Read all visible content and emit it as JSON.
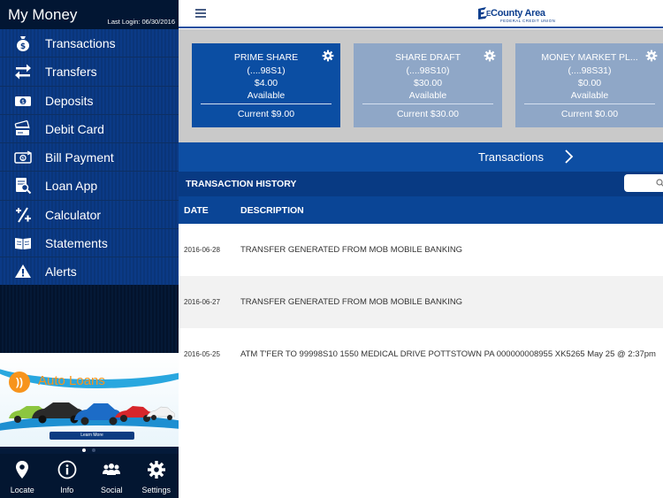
{
  "sidebar": {
    "title": "My Money",
    "last_login": "Last Login: 06/30/2016",
    "items": [
      {
        "label": "Transactions",
        "icon": "money-bag-icon"
      },
      {
        "label": "Transfers",
        "icon": "transfer-arrows-icon"
      },
      {
        "label": "Deposits",
        "icon": "camera-deposit-icon"
      },
      {
        "label": "Debit Card",
        "icon": "debit-card-icon"
      },
      {
        "label": "Bill Payment",
        "icon": "bill-payment-icon"
      },
      {
        "label": "Loan App",
        "icon": "loan-app-icon"
      },
      {
        "label": "Calculator",
        "icon": "calculator-icon"
      },
      {
        "label": "Statements",
        "icon": "statements-book-icon"
      },
      {
        "label": "Alerts",
        "icon": "alert-icon"
      }
    ]
  },
  "ad": {
    "title": "Auto Loans",
    "button": "Learn More",
    "badge": "))"
  },
  "bottom_nav": [
    {
      "label": "Locate",
      "icon": "location-pin-icon"
    },
    {
      "label": "Info",
      "icon": "info-icon"
    },
    {
      "label": "Social",
      "icon": "social-people-icon"
    },
    {
      "label": "Settings",
      "icon": "gear-icon"
    }
  ],
  "header": {
    "logo_main": "County Area",
    "logo_prefix": "E",
    "logo_sub": "FEDERAL CREDIT UNION"
  },
  "accounts": [
    {
      "name": "PRIME SHARE",
      "acct": "(....98S1)",
      "balance": "$4.00",
      "avail": "Available",
      "current": "Current $9.00",
      "active": true
    },
    {
      "name": "SHARE DRAFT",
      "acct": "(....98S10)",
      "balance": "$30.00",
      "avail": "Available",
      "current": "Current $30.00",
      "active": false
    },
    {
      "name": "MONEY MARKET PL...",
      "acct": "(....98S31)",
      "balance": "$0.00",
      "avail": "Available",
      "current": "Current $0.00",
      "active": false
    }
  ],
  "transactions_bar": {
    "label": "Transactions"
  },
  "history": {
    "title": "TRANSACTION HISTORY",
    "columns": {
      "date": "DATE",
      "description": "DESCRIPTION"
    },
    "rows": [
      {
        "date": "2016-06-28",
        "description": "TRANSFER GENERATED FROM MOB MOBILE BANKING"
      },
      {
        "date": "2016-06-27",
        "description": "TRANSFER GENERATED FROM MOB MOBILE BANKING"
      },
      {
        "date": "2016-05-25",
        "description": "ATM T'FER TO 99998S10 1550 MEDICAL DRIVE POTTSTOWN PA 000000008955 XK5265 May 25 @ 2:37pm"
      }
    ]
  },
  "colors": {
    "sidebar_bg": "#041a3a",
    "accent": "#0d4ea3",
    "card_active": "#0b4ea3",
    "card_inactive": "#8fa7c7",
    "ad_orange": "#f7941d"
  }
}
